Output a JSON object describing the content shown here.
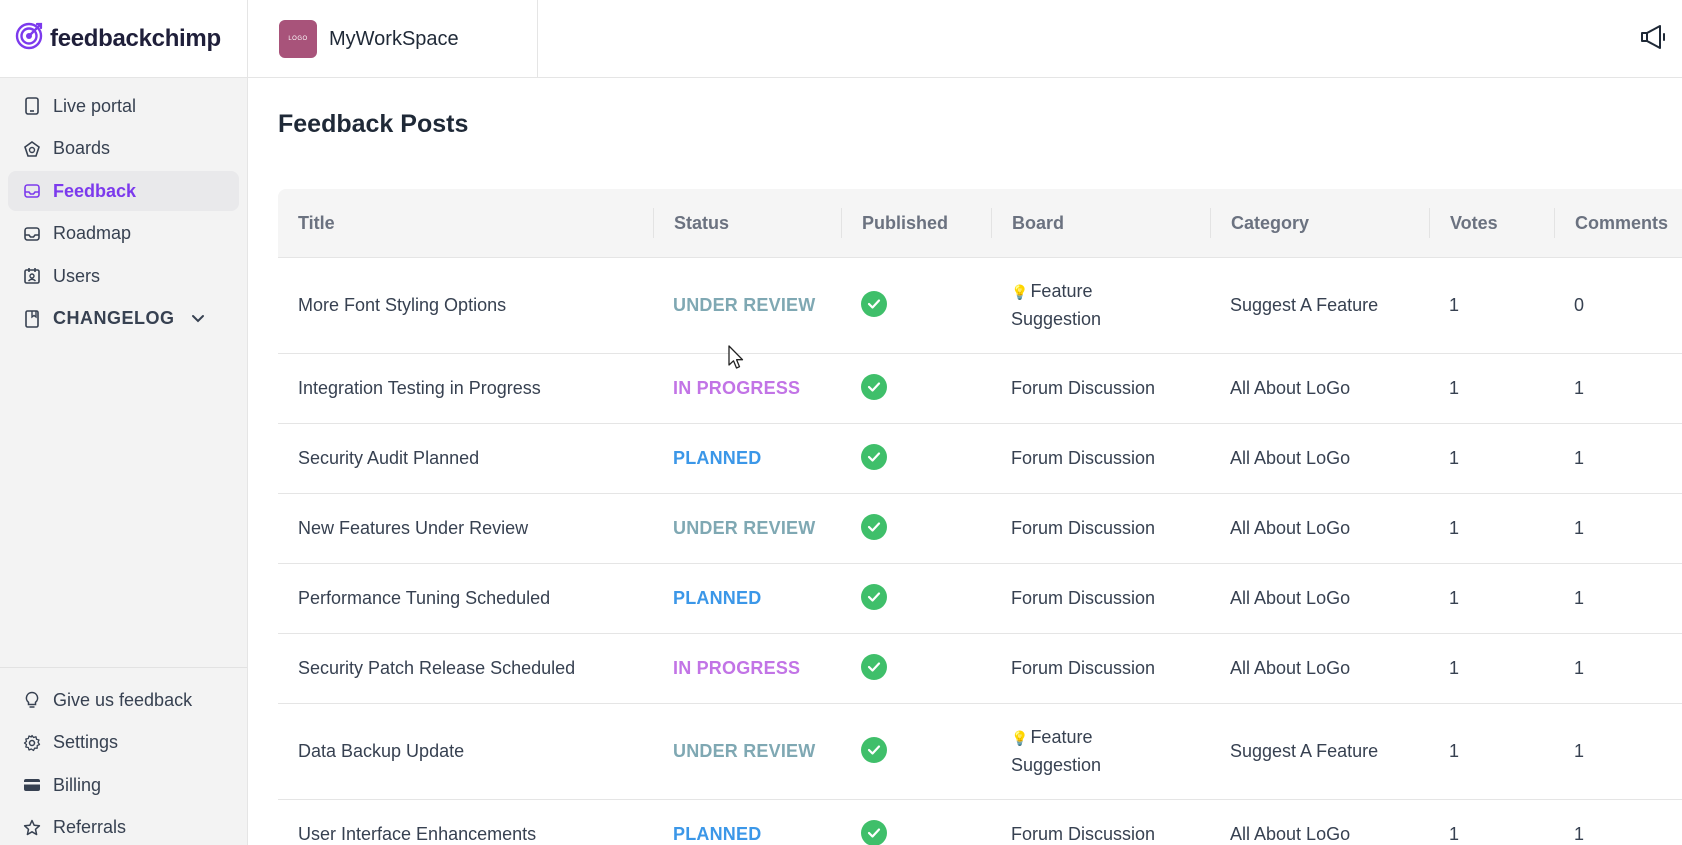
{
  "brand": {
    "name": "feedbackchimp"
  },
  "workspace": {
    "name": "MyWorkSpace",
    "logo_text": "LOGO"
  },
  "sidebar": {
    "items": [
      {
        "label": "Live portal",
        "icon": "tablet-icon"
      },
      {
        "label": "Boards",
        "icon": "boards-icon"
      },
      {
        "label": "Feedback",
        "icon": "inbox-icon",
        "active": true
      },
      {
        "label": "Roadmap",
        "icon": "roadmap-icon"
      },
      {
        "label": "Users",
        "icon": "users-icon"
      },
      {
        "label": "CHANGELOG",
        "icon": "book-icon",
        "expandable": true
      }
    ],
    "bottom_items": [
      {
        "label": "Give us feedback",
        "icon": "lightbulb-icon"
      },
      {
        "label": "Settings",
        "icon": "gear-icon"
      },
      {
        "label": "Billing",
        "icon": "card-icon"
      },
      {
        "label": "Referrals",
        "icon": "star-icon"
      }
    ]
  },
  "main": {
    "title": "Feedback Posts"
  },
  "table": {
    "columns": [
      "Title",
      "Status",
      "Published",
      "Board",
      "Category",
      "Votes",
      "Comments"
    ],
    "rows": [
      {
        "title": "More Font Styling Options",
        "status": "UNDER REVIEW",
        "status_kind": "review",
        "published": true,
        "board_emoji": "💡",
        "board": "Feature Suggestion",
        "category": "Suggest A Feature",
        "votes": "1",
        "comments": "0"
      },
      {
        "title": "Integration Testing in Progress",
        "status": "IN PROGRESS",
        "status_kind": "progress",
        "published": true,
        "board_emoji": "",
        "board": "Forum Discussion",
        "category": "All About LoGo",
        "votes": "1",
        "comments": "1"
      },
      {
        "title": "Security Audit Planned",
        "status": "PLANNED",
        "status_kind": "planned",
        "published": true,
        "board_emoji": "",
        "board": "Forum Discussion",
        "category": "All About LoGo",
        "votes": "1",
        "comments": "1"
      },
      {
        "title": "New Features Under Review",
        "status": "UNDER REVIEW",
        "status_kind": "review",
        "published": true,
        "board_emoji": "",
        "board": "Forum Discussion",
        "category": "All About LoGo",
        "votes": "1",
        "comments": "1"
      },
      {
        "title": "Performance Tuning Scheduled",
        "status": "PLANNED",
        "status_kind": "planned",
        "published": true,
        "board_emoji": "",
        "board": "Forum Discussion",
        "category": "All About LoGo",
        "votes": "1",
        "comments": "1"
      },
      {
        "title": "Security Patch Release Scheduled",
        "status": "IN PROGRESS",
        "status_kind": "progress",
        "published": true,
        "board_emoji": "",
        "board": "Forum Discussion",
        "category": "All About LoGo",
        "votes": "1",
        "comments": "1"
      },
      {
        "title": "Data Backup Update",
        "status": "UNDER REVIEW",
        "status_kind": "review",
        "published": true,
        "board_emoji": "💡",
        "board": "Feature Suggestion",
        "category": "Suggest A Feature",
        "votes": "1",
        "comments": "1"
      },
      {
        "title": "User Interface Enhancements",
        "status": "PLANNED",
        "status_kind": "planned",
        "published": true,
        "board_emoji": "",
        "board": "Forum Discussion",
        "category": "All About LoGo",
        "votes": "1",
        "comments": "1"
      }
    ]
  },
  "colors": {
    "accent": "#7c3aed",
    "status_review": "#7fa8b3",
    "status_progress": "#c274e6",
    "status_planned": "#3b97e8",
    "published_check": "#3fbf6a"
  }
}
